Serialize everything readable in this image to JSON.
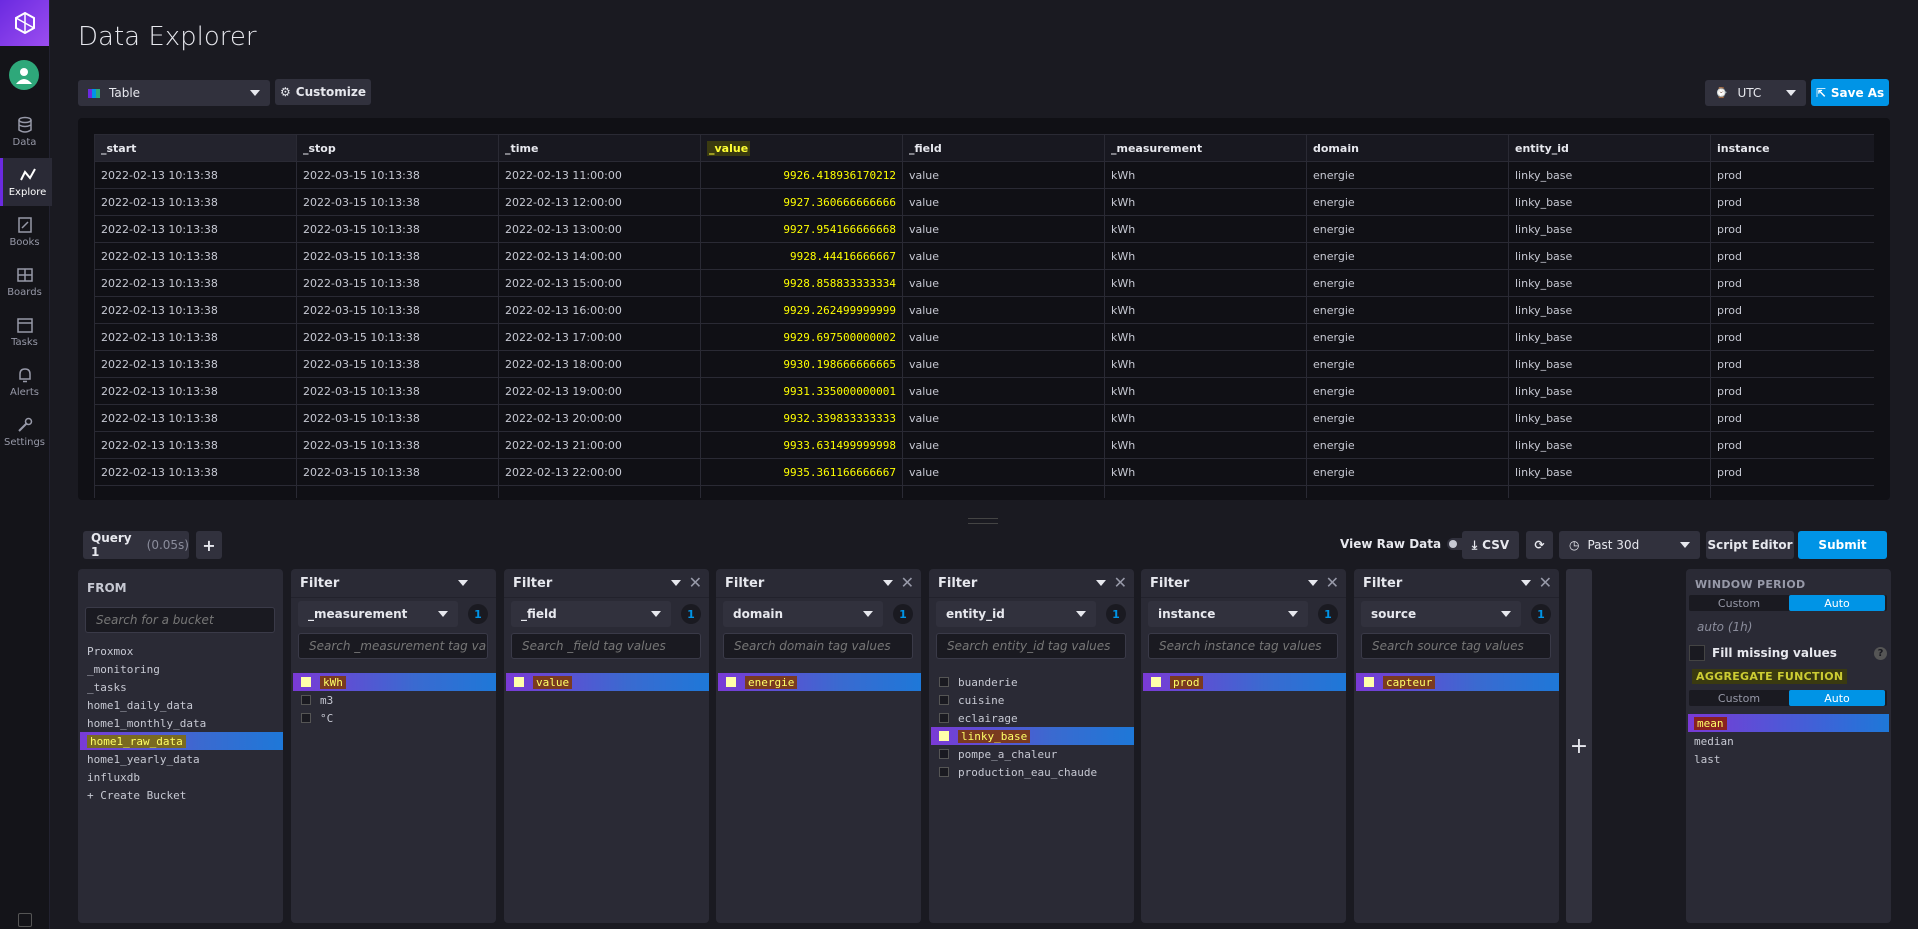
{
  "header": {
    "title": "Data Explorer",
    "view_type": "Table",
    "customize_label": "Customize",
    "timezone": "UTC",
    "save_as_label": "Save As"
  },
  "nav": {
    "items": [
      {
        "label": "Data",
        "icon": "database-icon"
      },
      {
        "label": "Explore",
        "icon": "graph-icon",
        "active": true
      },
      {
        "label": "Books",
        "icon": "notebook-icon"
      },
      {
        "label": "Boards",
        "icon": "dashboard-icon"
      },
      {
        "label": "Tasks",
        "icon": "calendar-icon"
      },
      {
        "label": "Alerts",
        "icon": "bell-icon"
      },
      {
        "label": "Settings",
        "icon": "wrench-icon"
      }
    ]
  },
  "table": {
    "columns": [
      "_start",
      "_stop",
      "_time",
      "_value",
      "_field",
      "_measurement",
      "domain",
      "entity_id",
      "instance"
    ],
    "rows": [
      [
        "2022-02-13 10:13:38",
        "2022-03-15 10:13:38",
        "2022-02-13 11:00:00",
        "9926.418936170212",
        "value",
        "kWh",
        "energie",
        "linky_base",
        "prod"
      ],
      [
        "2022-02-13 10:13:38",
        "2022-03-15 10:13:38",
        "2022-02-13 12:00:00",
        "9927.360666666666",
        "value",
        "kWh",
        "energie",
        "linky_base",
        "prod"
      ],
      [
        "2022-02-13 10:13:38",
        "2022-03-15 10:13:38",
        "2022-02-13 13:00:00",
        "9927.954166666668",
        "value",
        "kWh",
        "energie",
        "linky_base",
        "prod"
      ],
      [
        "2022-02-13 10:13:38",
        "2022-03-15 10:13:38",
        "2022-02-13 14:00:00",
        "9928.44416666667",
        "value",
        "kWh",
        "energie",
        "linky_base",
        "prod"
      ],
      [
        "2022-02-13 10:13:38",
        "2022-03-15 10:13:38",
        "2022-02-13 15:00:00",
        "9928.858833333334",
        "value",
        "kWh",
        "energie",
        "linky_base",
        "prod"
      ],
      [
        "2022-02-13 10:13:38",
        "2022-03-15 10:13:38",
        "2022-02-13 16:00:00",
        "9929.262499999999",
        "value",
        "kWh",
        "energie",
        "linky_base",
        "prod"
      ],
      [
        "2022-02-13 10:13:38",
        "2022-03-15 10:13:38",
        "2022-02-13 17:00:00",
        "9929.697500000002",
        "value",
        "kWh",
        "energie",
        "linky_base",
        "prod"
      ],
      [
        "2022-02-13 10:13:38",
        "2022-03-15 10:13:38",
        "2022-02-13 18:00:00",
        "9930.198666666665",
        "value",
        "kWh",
        "energie",
        "linky_base",
        "prod"
      ],
      [
        "2022-02-13 10:13:38",
        "2022-03-15 10:13:38",
        "2022-02-13 19:00:00",
        "9931.335000000001",
        "value",
        "kWh",
        "energie",
        "linky_base",
        "prod"
      ],
      [
        "2022-02-13 10:13:38",
        "2022-03-15 10:13:38",
        "2022-02-13 20:00:00",
        "9932.339833333333",
        "value",
        "kWh",
        "energie",
        "linky_base",
        "prod"
      ],
      [
        "2022-02-13 10:13:38",
        "2022-03-15 10:13:38",
        "2022-02-13 21:00:00",
        "9933.631499999998",
        "value",
        "kWh",
        "energie",
        "linky_base",
        "prod"
      ],
      [
        "2022-02-13 10:13:38",
        "2022-03-15 10:13:38",
        "2022-02-13 22:00:00",
        "9935.361166666667",
        "value",
        "kWh",
        "energie",
        "linky_base",
        "prod"
      ]
    ]
  },
  "query_bar": {
    "tab_label": "Query 1",
    "tab_time": "(0.05s)",
    "view_raw_label": "View Raw Data",
    "csv_label": "CSV",
    "time_range": "Past 30d",
    "script_editor_label": "Script Editor",
    "submit_label": "Submit"
  },
  "from": {
    "title": "FROM",
    "search_placeholder": "Search for a bucket",
    "buckets": [
      "Proxmox",
      "_monitoring",
      "_tasks",
      "home1_daily_data",
      "home1_monthly_data",
      "home1_raw_data",
      "home1_yearly_data",
      "influxdb",
      "+ Create Bucket"
    ],
    "selected_index": 5
  },
  "filters": [
    {
      "title": "Filter",
      "key": "_measurement",
      "count": "1",
      "placeholder": "Search _measurement tag va",
      "values": [
        "kWh",
        "m3",
        "°C"
      ],
      "selected": 0
    },
    {
      "title": "Filter",
      "key": "_field",
      "count": "1",
      "placeholder": "Search _field tag values",
      "values": [
        "value"
      ],
      "selected": 0
    },
    {
      "title": "Filter",
      "key": "domain",
      "count": "1",
      "placeholder": "Search domain tag values",
      "values": [
        "energie"
      ],
      "selected": 0
    },
    {
      "title": "Filter",
      "key": "entity_id",
      "count": "1",
      "placeholder": "Search entity_id tag values",
      "values": [
        "buanderie",
        "cuisine",
        "eclairage",
        "linky_base",
        "pompe_a_chaleur",
        "production_eau_chaude"
      ],
      "selected": 3
    },
    {
      "title": "Filter",
      "key": "instance",
      "count": "1",
      "placeholder": "Search instance tag values",
      "values": [
        "prod"
      ],
      "selected": 0
    },
    {
      "title": "Filter",
      "key": "source",
      "count": "1",
      "placeholder": "Search source tag values",
      "values": [
        "capteur"
      ],
      "selected": 0
    }
  ],
  "settings": {
    "window_period_title": "WINDOW PERIOD",
    "custom_label": "Custom",
    "auto_label": "Auto",
    "auto_value": "auto (1h)",
    "fill_missing_label": "Fill missing values",
    "aggregate_title": "AGGREGATE FUNCTION",
    "functions": [
      "mean",
      "median",
      "last"
    ],
    "selected_function": 0
  },
  "colors": {
    "accent": "#0094e6",
    "brand": "#6b2ae0",
    "value_highlight": "#ffff00"
  }
}
